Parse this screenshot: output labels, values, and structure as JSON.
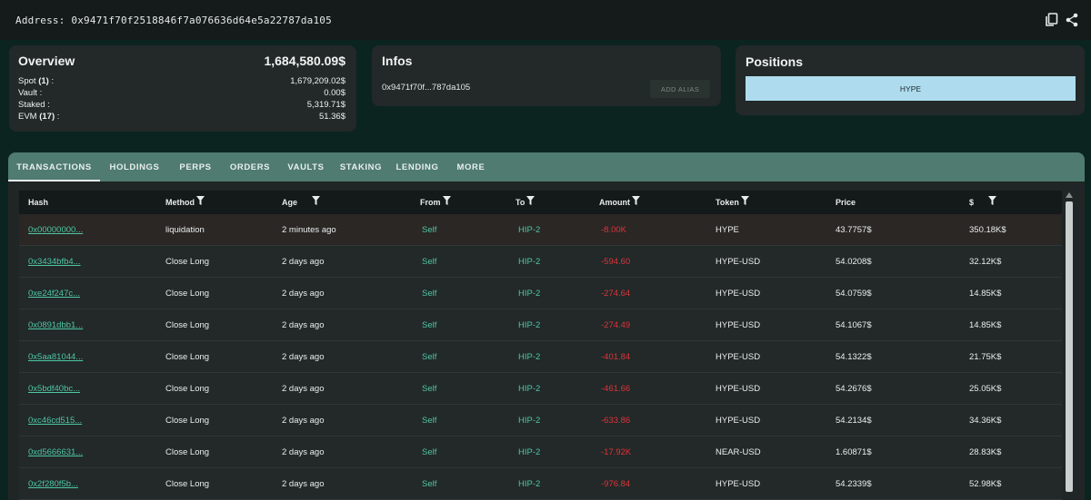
{
  "address_bar": {
    "label": "Address: 0x9471f70f2518846f7a076636d64e5a22787da105",
    "copy_icon": "copy-icon",
    "share_icon": "share-icon"
  },
  "overview": {
    "title": "Overview",
    "total": "1,684,580.09$",
    "rows": [
      {
        "label": "Spot",
        "count": "(1)",
        "suffix": " :",
        "value": "1,679,209.02$"
      },
      {
        "label": "Vault :",
        "count": "",
        "suffix": "",
        "value": "0.00$"
      },
      {
        "label": "Staked :",
        "count": "",
        "suffix": "",
        "value": "5,319.71$"
      },
      {
        "label": "EVM",
        "count": "(17)",
        "suffix": " :",
        "value": "51.36$"
      }
    ]
  },
  "infos": {
    "title": "Infos",
    "address_short": "0x9471f70f...787da105",
    "add_alias": "ADD ALIAS"
  },
  "positions": {
    "title": "Positions",
    "bar_label": "HYPE",
    "bar_color": "#aedcee"
  },
  "tabs": [
    {
      "label": "TRANSACTIONS",
      "active": true
    },
    {
      "label": "HOLDINGS",
      "active": false
    },
    {
      "label": "PERPS",
      "active": false
    },
    {
      "label": "ORDERS",
      "active": false
    },
    {
      "label": "VAULTS",
      "active": false
    },
    {
      "label": "STAKING",
      "active": false
    },
    {
      "label": "LENDING",
      "active": false
    },
    {
      "label": "MORE",
      "active": false
    }
  ],
  "table": {
    "headers": {
      "hash": "Hash",
      "method": "Method",
      "age": "Age",
      "from": "From",
      "to": "To",
      "amount": "Amount",
      "token": "Token",
      "price": "Price",
      "usd": "$"
    },
    "rows": [
      {
        "hash": "0x00000000...",
        "method": "liquidation",
        "age": "2 minutes ago",
        "from": "Self",
        "to": "HIP-2",
        "amount": "-8.00K",
        "token": "HYPE",
        "price": "43.7757$",
        "usd": "350.18K$"
      },
      {
        "hash": "0x3434bfb4...",
        "method": "Close Long",
        "age": "2 days ago",
        "from": "Self",
        "to": "HIP-2",
        "amount": "-594.60",
        "token": "HYPE-USD",
        "price": "54.0208$",
        "usd": "32.12K$"
      },
      {
        "hash": "0xe24f247c...",
        "method": "Close Long",
        "age": "2 days ago",
        "from": "Self",
        "to": "HIP-2",
        "amount": "-274.64",
        "token": "HYPE-USD",
        "price": "54.0759$",
        "usd": "14.85K$"
      },
      {
        "hash": "0x0891dbb1...",
        "method": "Close Long",
        "age": "2 days ago",
        "from": "Self",
        "to": "HIP-2",
        "amount": "-274.49",
        "token": "HYPE-USD",
        "price": "54.1067$",
        "usd": "14.85K$"
      },
      {
        "hash": "0x5aa81044...",
        "method": "Close Long",
        "age": "2 days ago",
        "from": "Self",
        "to": "HIP-2",
        "amount": "-401.84",
        "token": "HYPE-USD",
        "price": "54.1322$",
        "usd": "21.75K$"
      },
      {
        "hash": "0x5bdf40bc...",
        "method": "Close Long",
        "age": "2 days ago",
        "from": "Self",
        "to": "HIP-2",
        "amount": "-461.66",
        "token": "HYPE-USD",
        "price": "54.2676$",
        "usd": "25.05K$"
      },
      {
        "hash": "0xc46cd515...",
        "method": "Close Long",
        "age": "2 days ago",
        "from": "Self",
        "to": "HIP-2",
        "amount": "-633.86",
        "token": "HYPE-USD",
        "price": "54.2134$",
        "usd": "34.36K$"
      },
      {
        "hash": "0xd5666631...",
        "method": "Close Long",
        "age": "2 days ago",
        "from": "Self",
        "to": "HIP-2",
        "amount": "-17.92K",
        "token": "NEAR-USD",
        "price": "1.60871$",
        "usd": "28.83K$"
      },
      {
        "hash": "0x2f280f5b...",
        "method": "Close Long",
        "age": "2 days ago",
        "from": "Self",
        "to": "HIP-2",
        "amount": "-976.84",
        "token": "HYPE-USD",
        "price": "54.2339$",
        "usd": "52.98K$"
      }
    ]
  },
  "colors": {
    "accent_green": "#4fc6a3",
    "negative_red": "#e0323a",
    "tab_bar": "#4f7b70"
  }
}
